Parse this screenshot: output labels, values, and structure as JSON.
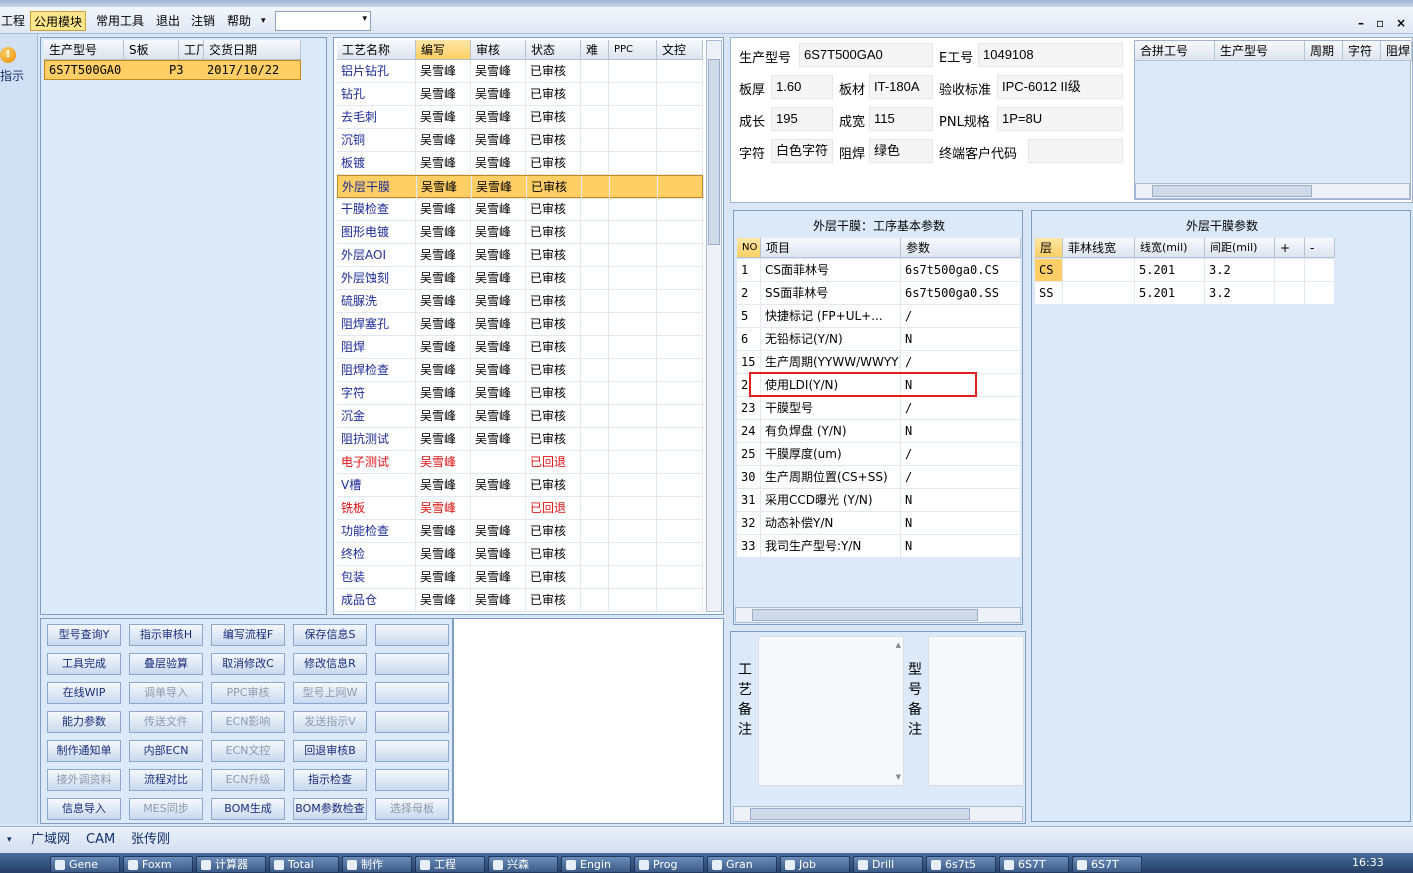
{
  "menu": {
    "items": [
      "工程",
      "公用模块",
      "常用工具",
      "退出",
      "注销",
      "帮助"
    ],
    "help_arrow": "▾"
  },
  "left_strip": {
    "label": "指示"
  },
  "orders": {
    "headers": [
      "生产型号",
      "S板",
      "工厂",
      "交货日期"
    ],
    "rows": [
      {
        "model": "6S7T500GA0",
        "s": "",
        "factory": "P3",
        "date": "2017/10/22"
      }
    ]
  },
  "process": {
    "headers": [
      "工艺名称",
      "编写",
      "审核",
      "状态",
      "难",
      "PPC",
      "文控"
    ],
    "rows": [
      {
        "name": "铝片钻孔",
        "writer": "吴雪峰",
        "reviewer": "吴雪峰",
        "status": "已审核"
      },
      {
        "name": "钻孔",
        "writer": "吴雪峰",
        "reviewer": "吴雪峰",
        "status": "已审核"
      },
      {
        "name": "去毛刺",
        "writer": "吴雪峰",
        "reviewer": "吴雪峰",
        "status": "已审核"
      },
      {
        "name": "沉铜",
        "writer": "吴雪峰",
        "reviewer": "吴雪峰",
        "status": "已审核"
      },
      {
        "name": "板镀",
        "writer": "吴雪峰",
        "reviewer": "吴雪峰",
        "status": "已审核"
      },
      {
        "name": "外层干膜",
        "writer": "吴雪峰",
        "reviewer": "吴雪峰",
        "status": "已审核"
      },
      {
        "name": "干膜检查",
        "writer": "吴雪峰",
        "reviewer": "吴雪峰",
        "status": "已审核"
      },
      {
        "name": "图形电镀",
        "writer": "吴雪峰",
        "reviewer": "吴雪峰",
        "status": "已审核"
      },
      {
        "name": "外层AOI",
        "writer": "吴雪峰",
        "reviewer": "吴雪峰",
        "status": "已审核"
      },
      {
        "name": "外层蚀刻",
        "writer": "吴雪峰",
        "reviewer": "吴雪峰",
        "status": "已审核"
      },
      {
        "name": "硫脲洗",
        "writer": "吴雪峰",
        "reviewer": "吴雪峰",
        "status": "已审核"
      },
      {
        "name": "阻焊塞孔",
        "writer": "吴雪峰",
        "reviewer": "吴雪峰",
        "status": "已审核"
      },
      {
        "name": "阻焊",
        "writer": "吴雪峰",
        "reviewer": "吴雪峰",
        "status": "已审核"
      },
      {
        "name": "阻焊检查",
        "writer": "吴雪峰",
        "reviewer": "吴雪峰",
        "status": "已审核"
      },
      {
        "name": "字符",
        "writer": "吴雪峰",
        "reviewer": "吴雪峰",
        "status": "已审核"
      },
      {
        "name": "沉金",
        "writer": "吴雪峰",
        "reviewer": "吴雪峰",
        "status": "已审核"
      },
      {
        "name": "阻抗测试",
        "writer": "吴雪峰",
        "reviewer": "吴雪峰",
        "status": "已审核"
      },
      {
        "name": "电子测试",
        "writer": "吴雪峰",
        "reviewer": "",
        "status": "已回退"
      },
      {
        "name": "V槽",
        "writer": "吴雪峰",
        "reviewer": "吴雪峰",
        "status": "已审核"
      },
      {
        "name": "铣板",
        "writer": "吴雪峰",
        "reviewer": "",
        "status": "已回退"
      },
      {
        "name": "功能检查",
        "writer": "吴雪峰",
        "reviewer": "吴雪峰",
        "status": "已审核"
      },
      {
        "name": "终检",
        "writer": "吴雪峰",
        "reviewer": "吴雪峰",
        "status": "已审核"
      },
      {
        "name": "包装",
        "writer": "吴雪峰",
        "reviewer": "吴雪峰",
        "status": "已审核"
      },
      {
        "name": "成品仓",
        "writer": "吴雪峰",
        "reviewer": "吴雪峰",
        "status": "已审核"
      }
    ]
  },
  "buttons": [
    [
      "型号查询Y",
      "指示审核H",
      "编写流程F",
      "保存信息S",
      ""
    ],
    [
      "工具完成",
      "叠层验算",
      "取消修改C",
      "修改信息R",
      ""
    ],
    [
      "在线WIP",
      "调单导入",
      "PPC审核",
      "型号上网W",
      ""
    ],
    [
      "能力参数",
      "传送文件",
      "ECN影响",
      "发送指示V",
      ""
    ],
    [
      "制作通知单",
      "内部ECN",
      "ECN文控",
      "回退审核B",
      ""
    ],
    [
      "接外调资料",
      "流程对比",
      "ECN升级",
      "指示检查",
      ""
    ],
    [
      "信息导入",
      "MES同步",
      "BOM生成",
      "BOM参数检查",
      "选择母板"
    ]
  ],
  "info": {
    "model_label": "生产型号",
    "model": "6S7T500GA0",
    "e_label": "E工号",
    "e_no": "1049108",
    "thick_label": "板厚",
    "thick": "1.60",
    "mat_label": "板材",
    "mat": "IT-180A",
    "std_label": "验收标准",
    "std": "IPC-6012 II级",
    "len_label": "成长",
    "len": "195",
    "wid_label": "成宽",
    "wid": "115",
    "pnl_label": "PNL规格",
    "pnl": "1P=8U",
    "char_label": "字符",
    "char": "白色字符",
    "mask_label": "阻焊",
    "mask": "绿色",
    "cust_label": "终端客户代码",
    "cust": ""
  },
  "merge": {
    "headers": [
      "合拼工号",
      "生产型号",
      "周期",
      "字符",
      "阻焊"
    ]
  },
  "params": {
    "title": "外层干膜：工序基本参数",
    "headers": [
      "NO",
      "项目",
      "参数"
    ],
    "rows": [
      {
        "no": "1",
        "item": "CS面菲林号",
        "val": "6s7t500ga0.CS"
      },
      {
        "no": "2",
        "item": "SS面菲林号",
        "val": "6s7t500ga0.SS"
      },
      {
        "no": "5",
        "item": "快捷标记 (FP+UL+...",
        "val": "/"
      },
      {
        "no": "6",
        "item": "无铅标记(Y/N)",
        "val": "N"
      },
      {
        "no": "15",
        "item": "生产周期(YYWW/WWYY)",
        "val": "/"
      },
      {
        "no": "2",
        "item": "使用LDI(Y/N)",
        "val": "N"
      },
      {
        "no": "23",
        "item": "干膜型号",
        "val": "/"
      },
      {
        "no": "24",
        "item": "有负焊盘 (Y/N)",
        "val": "N"
      },
      {
        "no": "25",
        "item": "干膜厚度(um)",
        "val": "/"
      },
      {
        "no": "30",
        "item": "生产周期位置(CS+SS)",
        "val": "/"
      },
      {
        "no": "31",
        "item": "采用CCD曝光 (Y/N)",
        "val": "N"
      },
      {
        "no": "32",
        "item": "动态补偿Y/N",
        "val": "N"
      },
      {
        "no": "33",
        "item": "我司生产型号:Y/N",
        "val": "N"
      }
    ]
  },
  "outer": {
    "title": "外层干膜参数",
    "headers": [
      "层",
      "菲林线宽",
      "线宽(mil)",
      "间距(mil)",
      "+",
      "-"
    ],
    "rows": [
      {
        "layer": "CS",
        "film": "",
        "lw": "5.201",
        "sp": "3.2"
      },
      {
        "layer": "SS",
        "film": "",
        "lw": "5.201",
        "sp": "3.2"
      }
    ]
  },
  "notes": {
    "proc": "工艺备注",
    "model": "型号备注"
  },
  "status": {
    "items": [
      "广域网",
      "CAM",
      "张传刚"
    ]
  },
  "taskbar": {
    "items": [
      "Gene",
      "Foxm",
      "计算器",
      "Total",
      "制作",
      "工程",
      "兴森",
      "Engin",
      "Prog",
      "Gran",
      "Job",
      "Drill",
      "6s7t5",
      "6S7T",
      "6S7T"
    ],
    "clock": "16:33"
  }
}
